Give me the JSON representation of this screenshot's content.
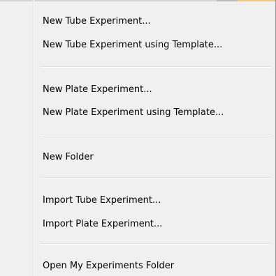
{
  "menu": {
    "groups": [
      {
        "items": [
          {
            "label": "New Tube Experiment..."
          },
          {
            "label": "New Tube Experiment using Template..."
          }
        ]
      },
      {
        "items": [
          {
            "label": "New Plate Experiment..."
          },
          {
            "label": "New Plate Experiment using Template..."
          }
        ]
      },
      {
        "items": [
          {
            "label": "New Folder"
          }
        ]
      },
      {
        "items": [
          {
            "label": "Import Tube Experiment..."
          },
          {
            "label": "Import Plate Experiment..."
          }
        ]
      },
      {
        "items": [
          {
            "label": "Open My Experiments Folder"
          }
        ]
      }
    ]
  }
}
